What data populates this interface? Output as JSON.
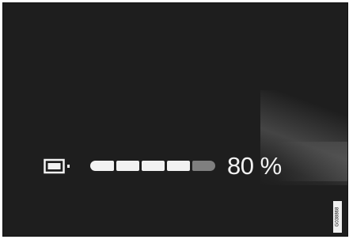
{
  "battery": {
    "icon": "battery-icon",
    "level_fraction": 0.8,
    "segments_total": 5,
    "segments_filled": 4,
    "percent_label": "80 %"
  },
  "figure_code": "G038868",
  "colors": {
    "background": "#1e1e1e",
    "segment_filled": "#f2f2f2",
    "segment_empty": "#7f7f7f",
    "text": "#f2f2f2"
  }
}
